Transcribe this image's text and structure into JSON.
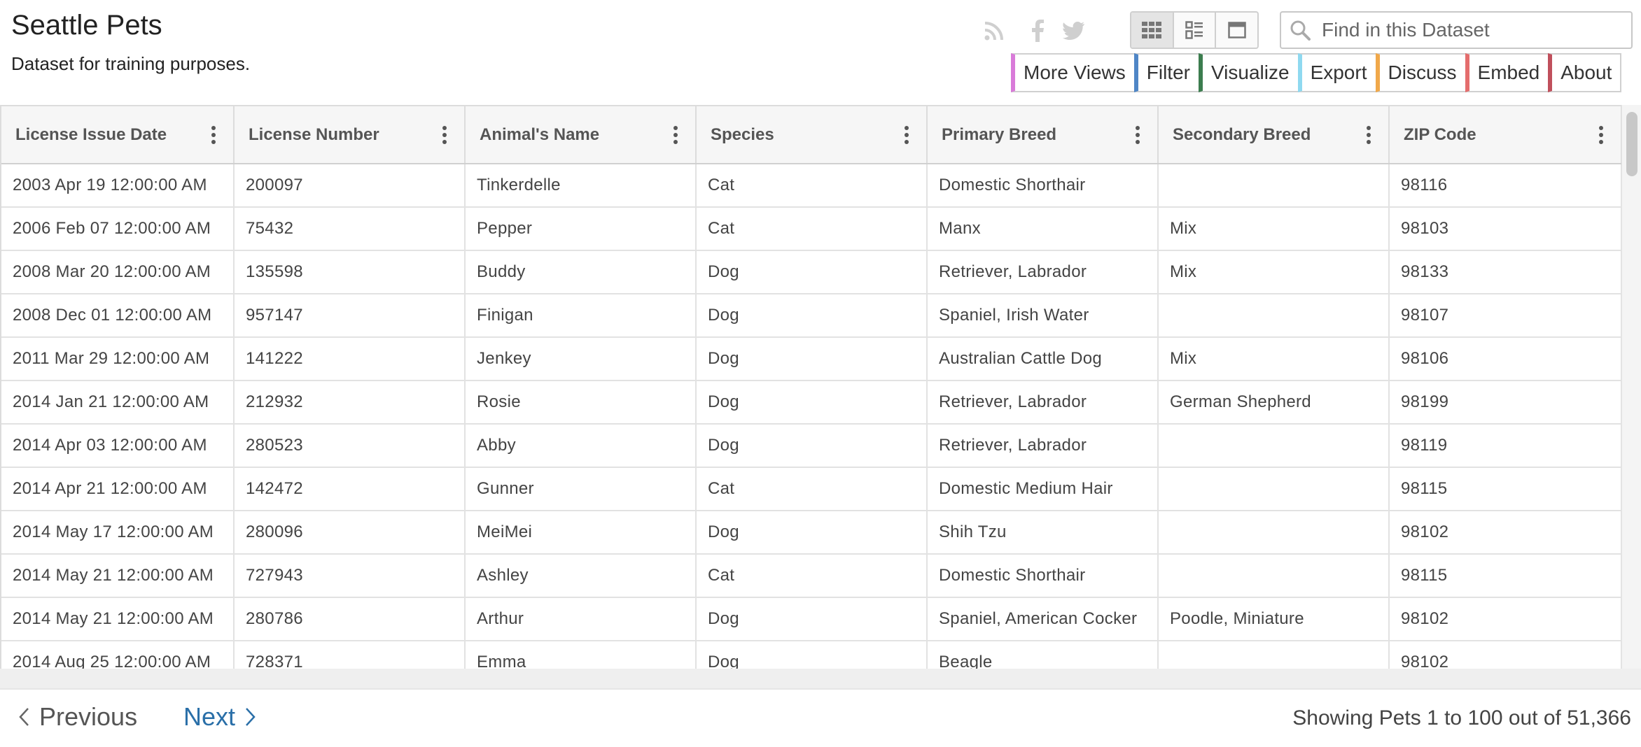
{
  "dataset": {
    "title": "Seattle Pets",
    "description": "Dataset for training purposes."
  },
  "social_icons": [
    "rss-icon",
    "facebook-icon",
    "twitter-icon"
  ],
  "view_buttons": [
    {
      "name": "grid-view-icon",
      "active": true
    },
    {
      "name": "row-view-icon",
      "active": false
    },
    {
      "name": "single-page-view-icon",
      "active": false
    }
  ],
  "search": {
    "placeholder": "Find in this Dataset",
    "value": ""
  },
  "toolbar": [
    {
      "label": "More Views",
      "color": "#d97bd9",
      "id": "more-views"
    },
    {
      "label": "Filter",
      "color": "#4f86c6",
      "id": "filter"
    },
    {
      "label": "Visualize",
      "color": "#3c7d4f",
      "id": "visualize"
    },
    {
      "label": "Export",
      "color": "#8fd9f0",
      "id": "export"
    },
    {
      "label": "Discuss",
      "color": "#f0a84a",
      "id": "discuss"
    },
    {
      "label": "Embed",
      "color": "#e46d6d",
      "id": "embed"
    },
    {
      "label": "About",
      "color": "#c0505c",
      "id": "about"
    }
  ],
  "table": {
    "columns": [
      "License Issue Date",
      "License Number",
      "Animal's Name",
      "Species",
      "Primary Breed",
      "Secondary Breed",
      "ZIP Code"
    ],
    "rows": [
      [
        "2003 Apr 19 12:00:00 AM",
        "200097",
        "Tinkerdelle",
        "Cat",
        "Domestic Shorthair",
        "",
        "98116"
      ],
      [
        "2006 Feb 07 12:00:00 AM",
        "75432",
        "Pepper",
        "Cat",
        "Manx",
        "Mix",
        "98103"
      ],
      [
        "2008 Mar 20 12:00:00 AM",
        "135598",
        "Buddy",
        "Dog",
        "Retriever, Labrador",
        "Mix",
        "98133"
      ],
      [
        "2008 Dec 01 12:00:00 AM",
        "957147",
        "Finigan",
        "Dog",
        "Spaniel, Irish Water",
        "",
        "98107"
      ],
      [
        "2011 Mar 29 12:00:00 AM",
        "141222",
        "Jenkey",
        "Dog",
        "Australian Cattle Dog",
        "Mix",
        "98106"
      ],
      [
        "2014 Jan 21 12:00:00 AM",
        "212932",
        "Rosie",
        "Dog",
        "Retriever, Labrador",
        "German Shepherd",
        "98199"
      ],
      [
        "2014 Apr 03 12:00:00 AM",
        "280523",
        "Abby",
        "Dog",
        "Retriever, Labrador",
        "",
        "98119"
      ],
      [
        "2014 Apr 21 12:00:00 AM",
        "142472",
        "Gunner",
        "Cat",
        "Domestic Medium Hair",
        "",
        "98115"
      ],
      [
        "2014 May 17 12:00:00 AM",
        "280096",
        "MeiMei",
        "Dog",
        "Shih Tzu",
        "",
        "98102"
      ],
      [
        "2014 May 21 12:00:00 AM",
        "727943",
        "Ashley",
        "Cat",
        "Domestic Shorthair",
        "",
        "98115"
      ],
      [
        "2014 May 21 12:00:00 AM",
        "280786",
        "Arthur",
        "Dog",
        "Spaniel, American Cocker",
        "Poodle, Miniature",
        "98102"
      ],
      [
        "2014 Aug 25 12:00:00 AM",
        "728371",
        "Emma",
        "Dog",
        "Beagle",
        "",
        "98102"
      ]
    ]
  },
  "pagination": {
    "previous_label": "Previous",
    "next_label": "Next",
    "showing_text": "Showing Pets 1 to 100 out of 51,366"
  }
}
